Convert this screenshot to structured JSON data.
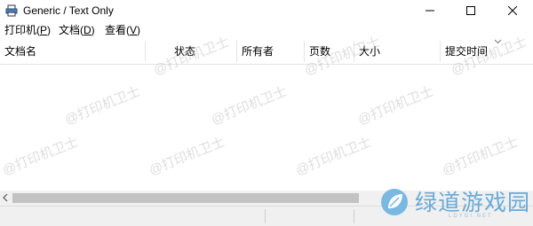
{
  "window": {
    "title": "Generic / Text Only",
    "controls": {
      "minimize": "minimize-icon",
      "maximize": "maximize-icon",
      "close": "close-icon"
    }
  },
  "menu": {
    "printer": "打印机(P)",
    "printer_key": "P",
    "document": "文档(D)",
    "document_key": "D",
    "view": "查看(V)",
    "view_key": "V"
  },
  "columns": [
    "文档名",
    "状态",
    "所有者",
    "页数",
    "大小",
    "提交时间"
  ],
  "watermark_text": "@打印机卫士",
  "logo": {
    "main": "绿道游戏园",
    "sub": "LDYGI.NET"
  },
  "colors": {
    "logo_blue": "#6aaad8",
    "scroll_thumb": "#c2c2c2",
    "status_bg": "#f0f0f0"
  }
}
